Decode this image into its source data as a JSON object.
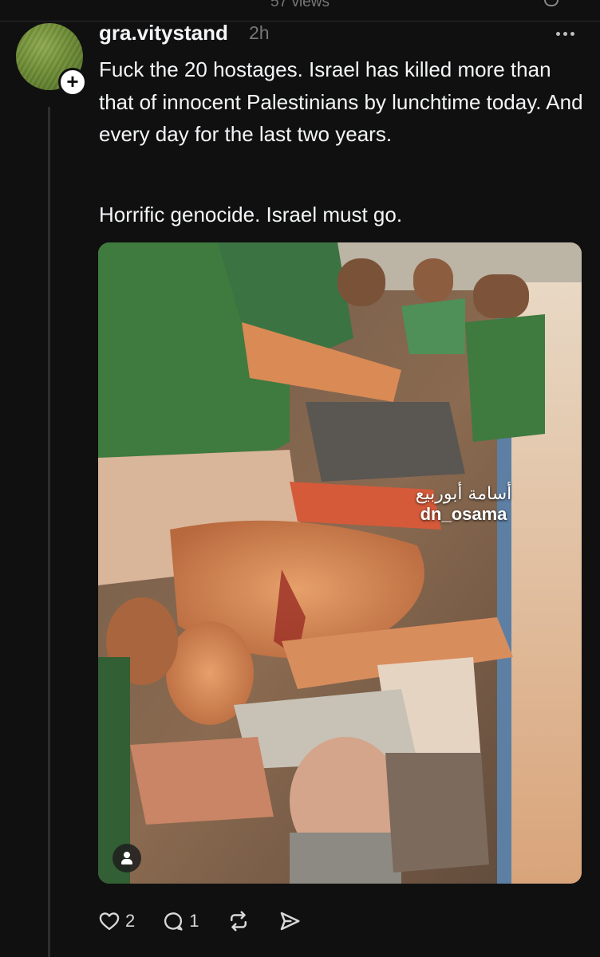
{
  "header": {
    "views_text": "57 views"
  },
  "post": {
    "username": "gra.vitystand",
    "timestamp": "2h",
    "paragraphs": [
      "Fuck the 20 hostages. Israel has killed more than that of innocent Palestinians by lunchtime today. And every day for the last two years.",
      "Horrific genocide. Israel must go."
    ],
    "media": {
      "watermark_arabic": "أسامة أبوربيع",
      "watermark_handle": "dn_osama"
    },
    "actions": {
      "like_count": "2",
      "reply_count": "1"
    }
  },
  "icons": {
    "avatar": "avatar",
    "follow": "plus-icon",
    "more": "more-horizontal-icon",
    "like": "heart-icon",
    "reply": "comment-icon",
    "repost": "repost-icon",
    "share": "send-icon",
    "tag": "person-tag-icon"
  }
}
